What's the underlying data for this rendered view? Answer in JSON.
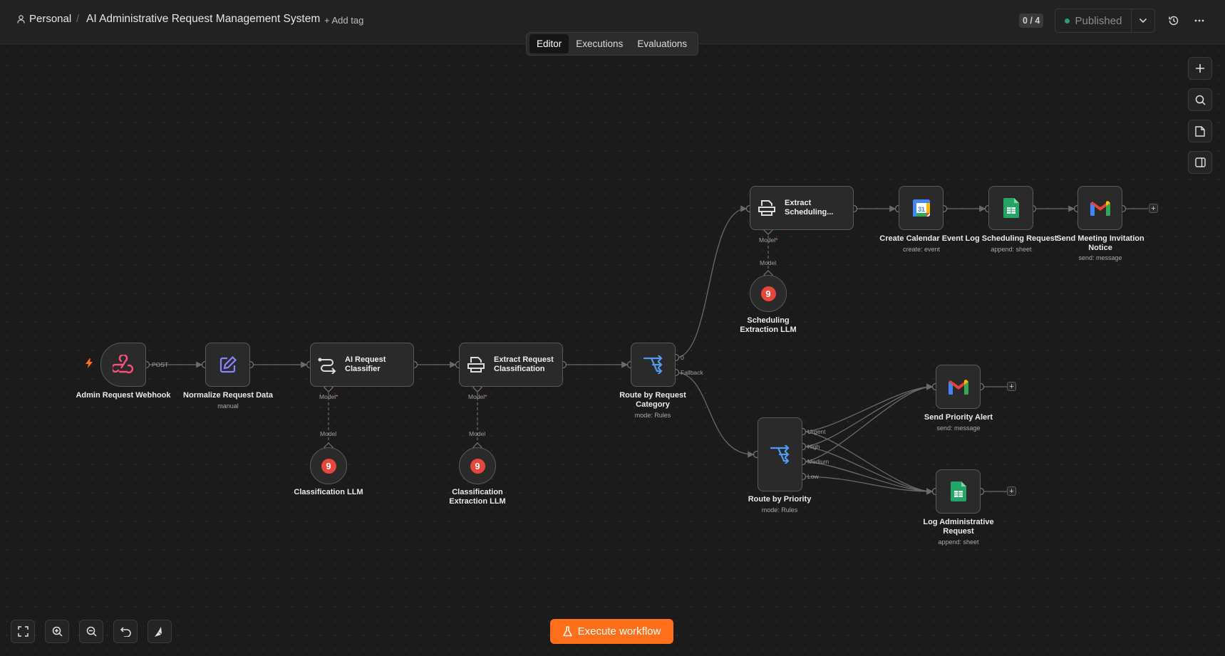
{
  "header": {
    "personal_label": "Personal",
    "separator": "/",
    "workflow_title": "AI Administrative Request Management System",
    "add_tag_label": "+ Add tag",
    "version_counter": "0 / 4",
    "publish_label": "Published"
  },
  "tabs": [
    "Editor",
    "Executions",
    "Evaluations"
  ],
  "nodes": {
    "webhook": {
      "label": "Admin Request Webhook"
    },
    "normalize": {
      "label": "Normalize Request Data",
      "sub": "manual"
    },
    "classifier": {
      "title": "AI Request Classifier"
    },
    "extract_class": {
      "title": "Extract Request Classification"
    },
    "route_category": {
      "label": "Route by Request Category",
      "sub": "mode: Rules"
    },
    "extract_sched": {
      "title": "Extract Scheduling..."
    },
    "calendar": {
      "label": "Create Calendar Event",
      "sub": "create: event"
    },
    "log_sched": {
      "label": "Log Scheduling Request",
      "sub": "append: sheet"
    },
    "send_invite": {
      "label": "Send Meeting Invitation Notice",
      "sub": "send: message"
    },
    "sched_llm": {
      "label": "Scheduling Extraction LLM"
    },
    "class_llm": {
      "label": "Classification LLM"
    },
    "class_extract_llm": {
      "label": "Classification Extraction LLM"
    },
    "route_priority": {
      "label": "Route by Priority",
      "sub": "mode: Rules"
    },
    "priority_alert": {
      "label": "Send Priority Alert",
      "sub": "send: message"
    },
    "log_admin": {
      "label": "Log Administrative Request",
      "sub": "append: sheet"
    }
  },
  "connection_labels": {
    "post": "POST",
    "model": "Model",
    "required_mark": "*",
    "output_zero": "0",
    "fallback": "Fallback",
    "urgent": "Urgent",
    "high": "High",
    "medium": "Medium",
    "low": "Low"
  },
  "llm_badge_glyph": "9",
  "calendar_badge": "31",
  "execute_label": "Execute workflow",
  "colors": {
    "accent_orange": "#ff6f1a",
    "webhook_pink": "#ff4f7b",
    "router_blue": "#4f9cf0",
    "edit_purple": "#8a84ff",
    "sheets_green": "#23a566",
    "llm_red": "#e5483a",
    "published_dot": "#2f9e6f"
  },
  "icons": {
    "personal": "user-icon",
    "history": "history-icon",
    "more": "more-icon",
    "zoom_in": "zoom-in-icon",
    "zoom_out": "zoom-out-icon",
    "undo": "undo-icon",
    "fit": "fit-view-icon",
    "tidy": "tidy-up-icon"
  }
}
